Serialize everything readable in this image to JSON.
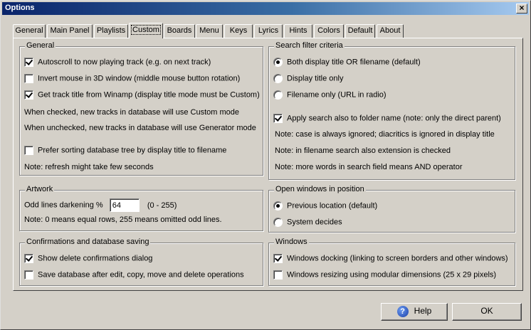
{
  "window": {
    "title": "Options",
    "close_glyph": "×"
  },
  "tabs": [
    {
      "label": "General"
    },
    {
      "label": "Main Panel"
    },
    {
      "label": "Playlists"
    },
    {
      "label": "Custom"
    },
    {
      "label": "Boards"
    },
    {
      "label": "Menu"
    },
    {
      "label": "Keys"
    },
    {
      "label": "Lyrics"
    },
    {
      "label": "Hints"
    },
    {
      "label": "Colors"
    },
    {
      "label": "Default"
    },
    {
      "label": "About"
    }
  ],
  "active_tab": "Custom",
  "general": {
    "title": "General",
    "autoscroll": {
      "label": "Autoscroll to now playing track (e.g. on next track)",
      "checked": true
    },
    "invert_mouse": {
      "label": "Invert mouse in 3D window (middle mouse button rotation)",
      "checked": false
    },
    "track_title": {
      "label": "Get track title from Winamp (display title mode must be Custom)",
      "checked": true
    },
    "note_checked": "When checked, new tracks in database will use Custom mode",
    "note_unchecked": "When unchecked, new tracks in database will use Generator mode",
    "prefer_sorting": {
      "label": "Prefer sorting database tree by display title to filename",
      "checked": false
    },
    "note_refresh": "Note: refresh might take few seconds"
  },
  "artwork": {
    "title": "Artwork",
    "darkening_label": "Odd lines darkening %",
    "darkening_value": "64",
    "range": "(0 - 255)",
    "note": "Note: 0 means equal rows, 255 means omitted odd lines."
  },
  "confirmations": {
    "title": "Confirmations and database saving",
    "show_delete": {
      "label": "Show delete confirmations dialog",
      "checked": true
    },
    "save_db": {
      "label": "Save database after edit, copy, move and delete operations",
      "checked": false
    }
  },
  "search": {
    "title": "Search filter criteria",
    "both": {
      "label": "Both display title OR filename (default)",
      "selected": true
    },
    "display_only": {
      "label": "Display title only",
      "selected": false
    },
    "filename_only": {
      "label": "Filename only (URL in radio)",
      "selected": false
    },
    "folder_name": {
      "label": "Apply search also to folder name (note: only the direct parent)",
      "checked": true
    },
    "note1": "Note: case is always ignored; diacritics is ignored in display title",
    "note2": "Note: in filename search also extension is checked",
    "note3": "Note: more words in search field means AND operator"
  },
  "open_windows": {
    "title": "Open windows in position",
    "previous": {
      "label": "Previous location (default)",
      "selected": true
    },
    "system": {
      "label": "System decides",
      "selected": false
    }
  },
  "windows": {
    "title": "Windows",
    "docking": {
      "label": "Windows docking (linking to screen borders and other windows)",
      "checked": true
    },
    "resizing": {
      "label": "Windows resizing using modular dimensions (25 x 29 pixels)",
      "checked": false
    }
  },
  "buttons": {
    "help": "Help",
    "help_glyph": "?",
    "ok": "OK"
  }
}
